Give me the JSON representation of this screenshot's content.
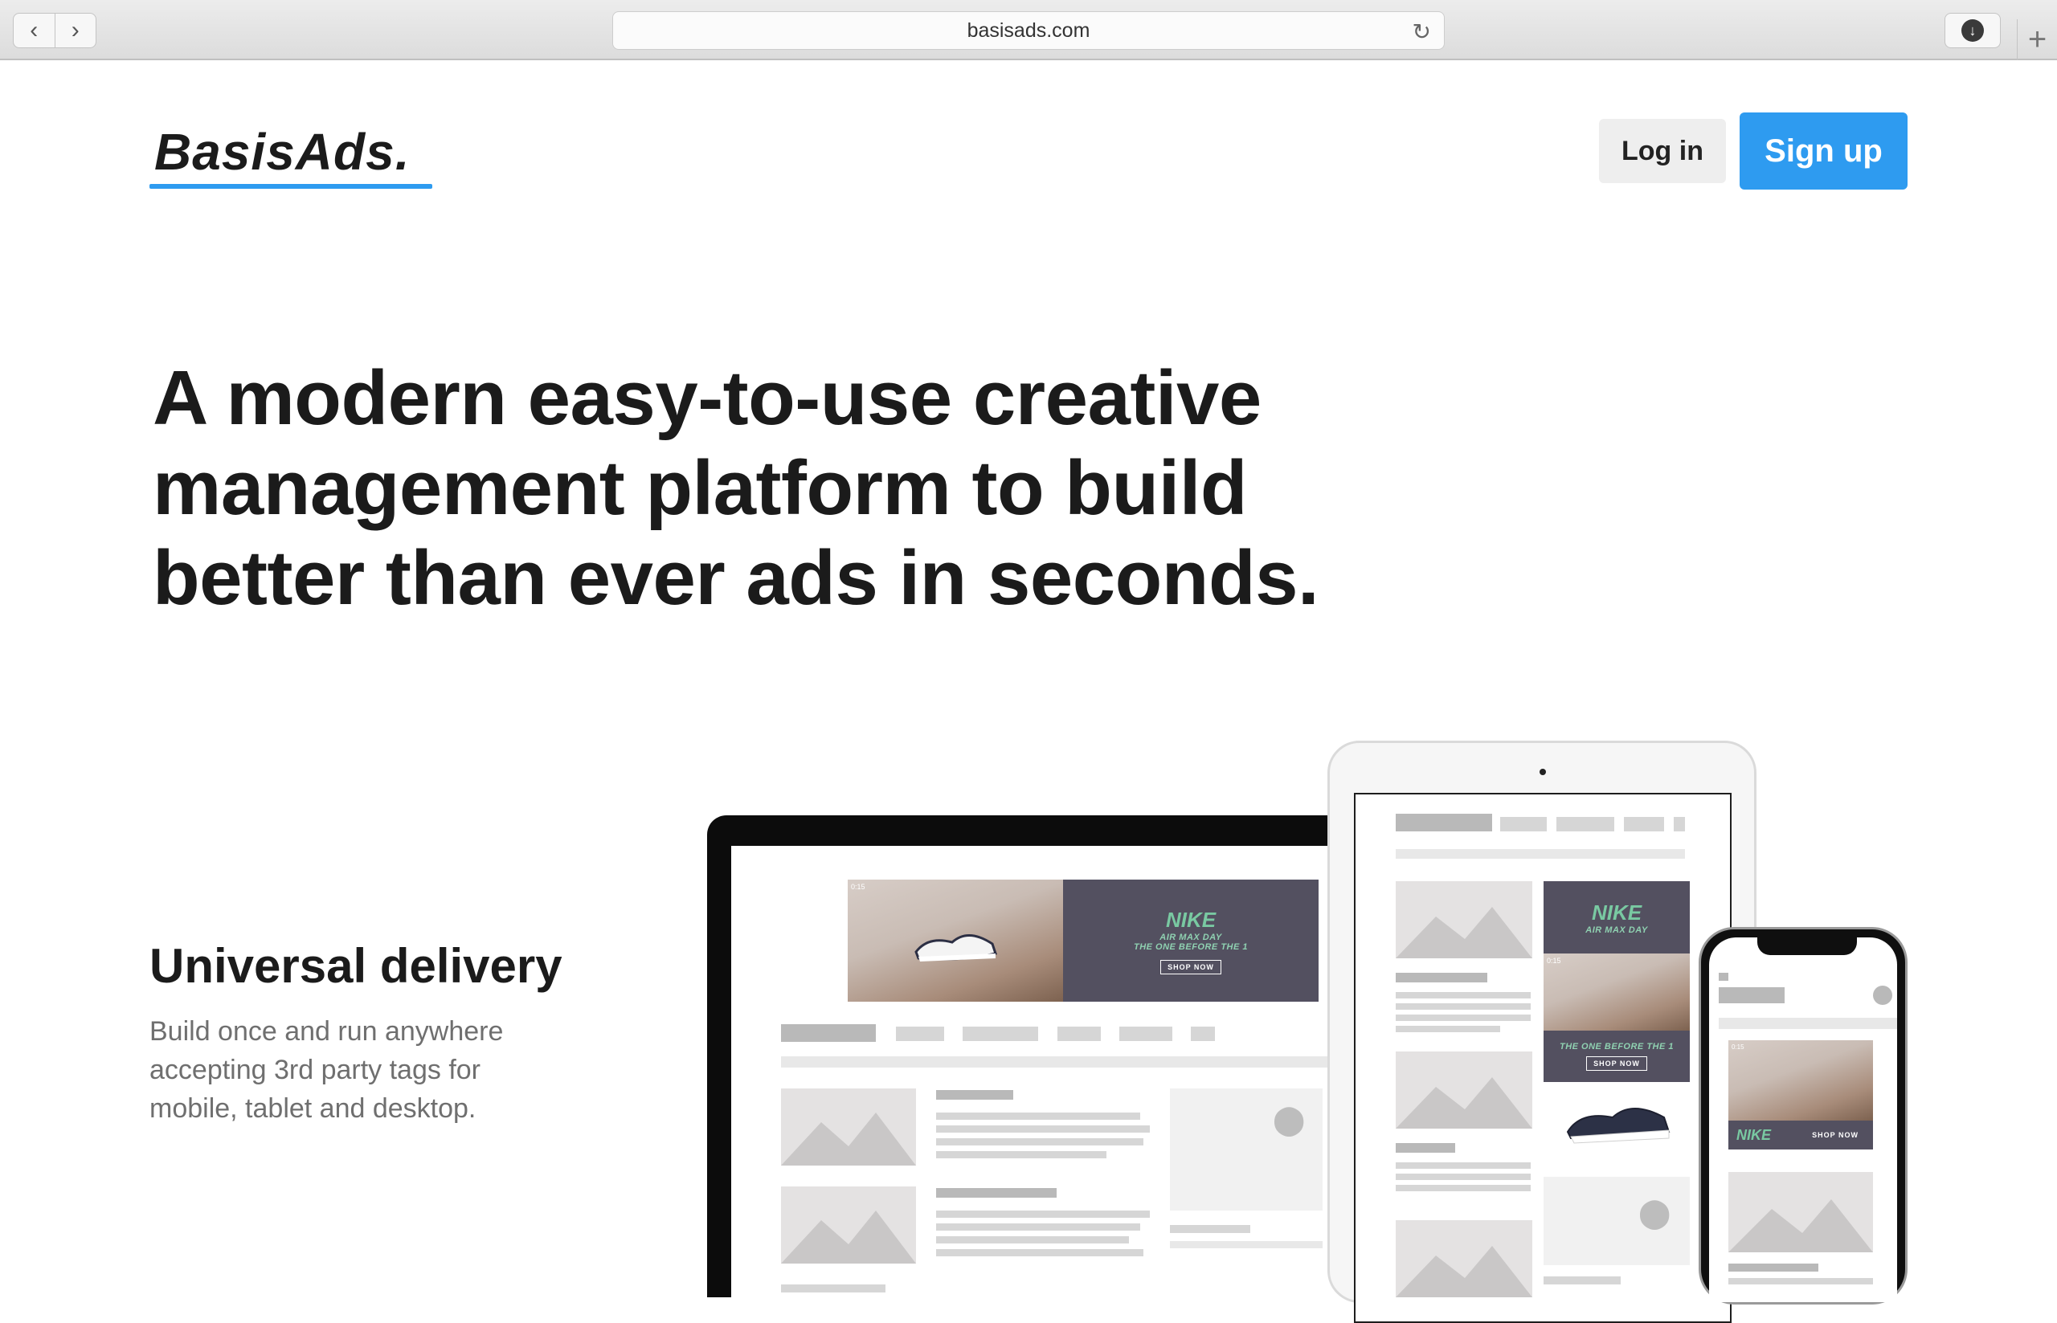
{
  "browser": {
    "url": "basisads.com",
    "back_icon": "‹",
    "forward_icon": "›",
    "reload_icon": "↻",
    "download_icon": "↓",
    "newtab_icon": "+"
  },
  "header": {
    "logo": "BasisAds.",
    "login_label": "Log in",
    "signup_label": "Sign up"
  },
  "hero": {
    "line1": "A modern easy-to-use creative",
    "line2": "management platform to build",
    "line3": "better than ever ads in seconds."
  },
  "feature": {
    "title": "Universal delivery",
    "desc_line1": "Build once and run anywhere",
    "desc_line2": "accepting 3rd party tags for",
    "desc_line3": "mobile, tablet and desktop."
  },
  "ad": {
    "brand": "NIKE",
    "line1": "AIR MAX DAY",
    "line2": "THE ONE BEFORE THE 1",
    "cta": "SHOP NOW",
    "timer": "0:15"
  },
  "colors": {
    "accent": "#2e9bf0",
    "ad_panel": "#535060",
    "ad_text": "#8fd1b1"
  }
}
